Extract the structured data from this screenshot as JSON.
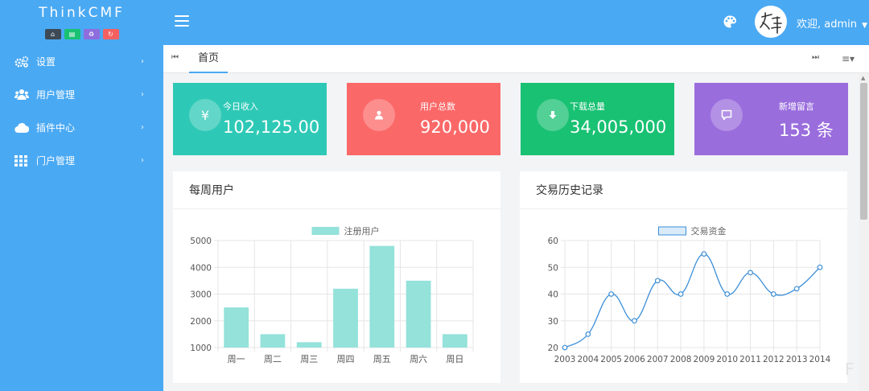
{
  "brand": {
    "title": "ThinkCMF"
  },
  "brand_buttons": [
    {
      "icon": "home-icon",
      "color": "#3d4a56"
    },
    {
      "icon": "file-icon",
      "color": "#19c173"
    },
    {
      "icon": "recycle-icon",
      "color": "#8e6ddd"
    },
    {
      "icon": "refresh-icon",
      "color": "#f46060"
    }
  ],
  "sidebar": {
    "items": [
      {
        "label": "设置",
        "icon": "gears-icon"
      },
      {
        "label": "用户管理",
        "icon": "users-icon"
      },
      {
        "label": "插件中心",
        "icon": "cloud-icon"
      },
      {
        "label": "门户管理",
        "icon": "grid-icon"
      }
    ]
  },
  "header": {
    "welcome": "欢迎, admin"
  },
  "tabs": {
    "home": "首页"
  },
  "stats": [
    {
      "label": "今日收入",
      "value": "102,125.00",
      "icon": "yen-icon",
      "glyph": "¥",
      "color": "#2ec9b6"
    },
    {
      "label": "用户总数",
      "value": "920,000",
      "icon": "user-icon",
      "glyph": "",
      "color": "#fb6868"
    },
    {
      "label": "下载总量",
      "value": "34,005,000",
      "icon": "download-icon",
      "glyph": "",
      "color": "#19c173"
    },
    {
      "label": "新增留言",
      "value": "153 条",
      "icon": "message-icon",
      "glyph": "",
      "color": "#9a6ddd"
    }
  ],
  "panels": {
    "weekly": "每周用户",
    "history": "交易历史记录"
  },
  "watermark": "F",
  "chart_data": [
    {
      "type": "bar",
      "categories": [
        "周一",
        "周二",
        "周三",
        "周四",
        "周五",
        "周六",
        "周日"
      ],
      "series": [
        {
          "name": "注册用户",
          "values": [
            2500,
            1500,
            1200,
            3200,
            4800,
            3500,
            1500
          ],
          "color": "#94e2da"
        }
      ],
      "ylim": [
        1000,
        5000
      ],
      "yticks": [
        1000,
        2000,
        3000,
        4000,
        5000
      ],
      "legend": "top",
      "grid": true
    },
    {
      "type": "line",
      "x": [
        "2003",
        "2004",
        "2005",
        "2006",
        "2007",
        "2008",
        "2009",
        "2010",
        "2011",
        "2012",
        "2013",
        "2014"
      ],
      "series": [
        {
          "name": "交易资金",
          "values": [
            20,
            25,
            40,
            30,
            45,
            40,
            55,
            40,
            48,
            40,
            42,
            50
          ],
          "color": "#3b8ed8"
        }
      ],
      "ylim": [
        20,
        60
      ],
      "yticks": [
        20,
        30,
        40,
        50,
        60
      ],
      "legend": "top",
      "grid": true
    }
  ]
}
